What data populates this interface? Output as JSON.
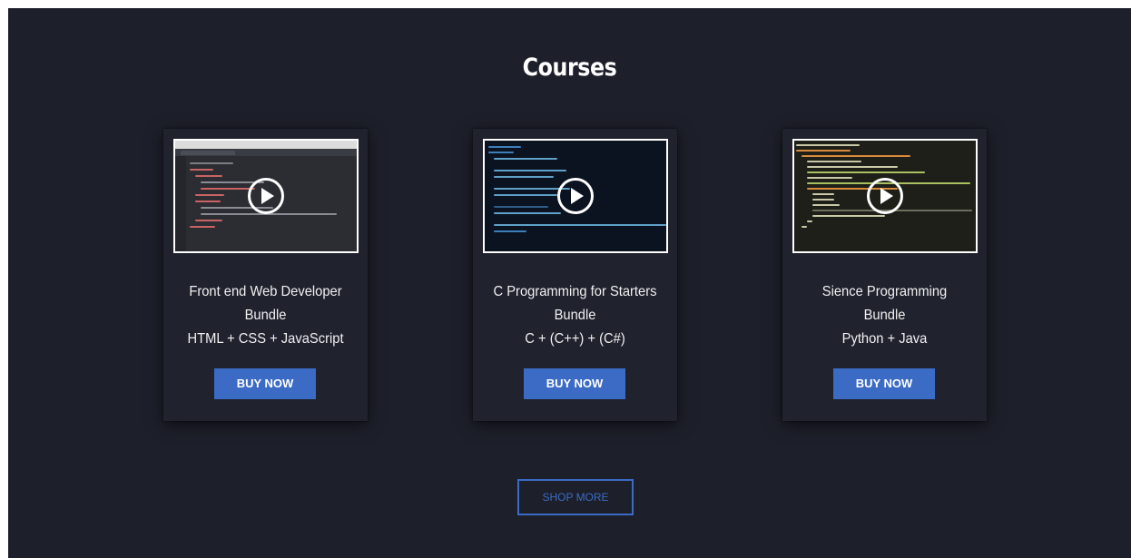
{
  "section": {
    "title": "Courses"
  },
  "courses": [
    {
      "line1": "Front end Web Developer",
      "line2": "Bundle",
      "line3": "HTML + CSS + JavaScript",
      "button": "BUY NOW",
      "play_icon": "play-icon"
    },
    {
      "line1": "C Programming for Starters",
      "line2": "Bundle",
      "line3": "C + (C++) + (C#)",
      "button": "BUY NOW",
      "play_icon": "play-icon"
    },
    {
      "line1": "Sience Programming",
      "line2": "Bundle",
      "line3": "Python + Java",
      "button": "BUY NOW",
      "play_icon": "play-icon"
    }
  ],
  "shop_more": {
    "label": "SHOP MORE"
  },
  "colors": {
    "background": "#1d1f2a",
    "card": "#20222e",
    "accent": "#3b6bc4",
    "text": "#ffffff"
  }
}
